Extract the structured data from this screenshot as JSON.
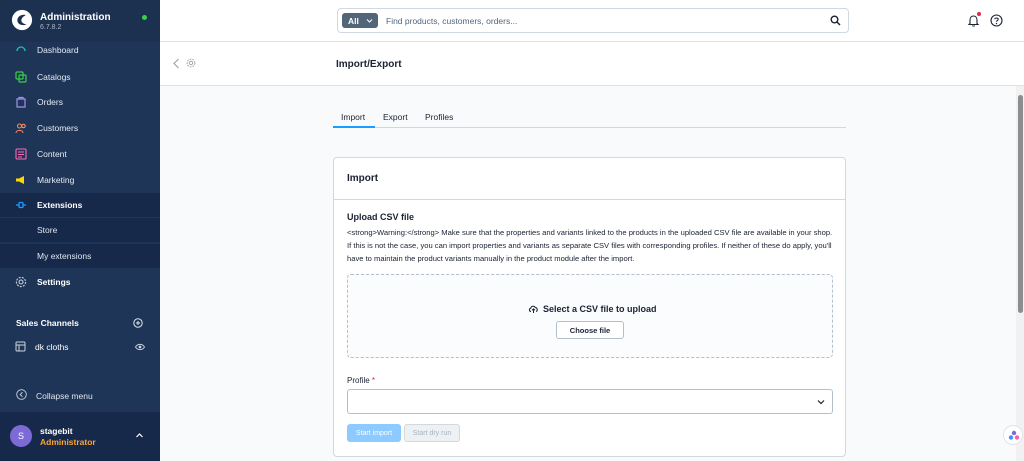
{
  "brand": {
    "title": "Administration",
    "version": "6.7.8.2",
    "status_color": "#37d046"
  },
  "nav": {
    "dashboard": "Dashboard",
    "catalogs": "Catalogs",
    "orders": "Orders",
    "customers": "Customers",
    "content": "Content",
    "marketing": "Marketing",
    "extensions": "Extensions",
    "store": "Store",
    "my_extensions": "My extensions",
    "settings": "Settings"
  },
  "sales_channels": {
    "title": "Sales Channels",
    "items": [
      {
        "label": "dk cloths"
      }
    ]
  },
  "collapse_label": "Collapse menu",
  "user": {
    "initial": "S",
    "name": "stagebit",
    "role": "Administrator"
  },
  "search": {
    "scope": "All",
    "placeholder": "Find products, customers, orders..."
  },
  "page": {
    "title": "Import/Export"
  },
  "tabs": [
    {
      "label": "Import"
    },
    {
      "label": "Export"
    },
    {
      "label": "Profiles"
    }
  ],
  "card": {
    "title": "Import",
    "upload_title": "Upload CSV file",
    "warning": "<strong>Warning:</strong> Make sure that the properties and variants linked to the products in the uploaded CSV file are available in your shop. If this is not the case, you can import properties and variants as separate CSV files with corresponding profiles. If neither of these do apply, you'll have to maintain the product variants manually in the product module after the import.",
    "dropzone_label": "Select a CSV file to upload",
    "choose_button": "Choose file",
    "profile_label": "Profile",
    "profile_required": "*",
    "start_import": "Start import",
    "start_dry_run": "Start dry run"
  },
  "colors": {
    "sidebar": "#1f3557",
    "accent": "#189eff",
    "role": "#ffa52e"
  }
}
